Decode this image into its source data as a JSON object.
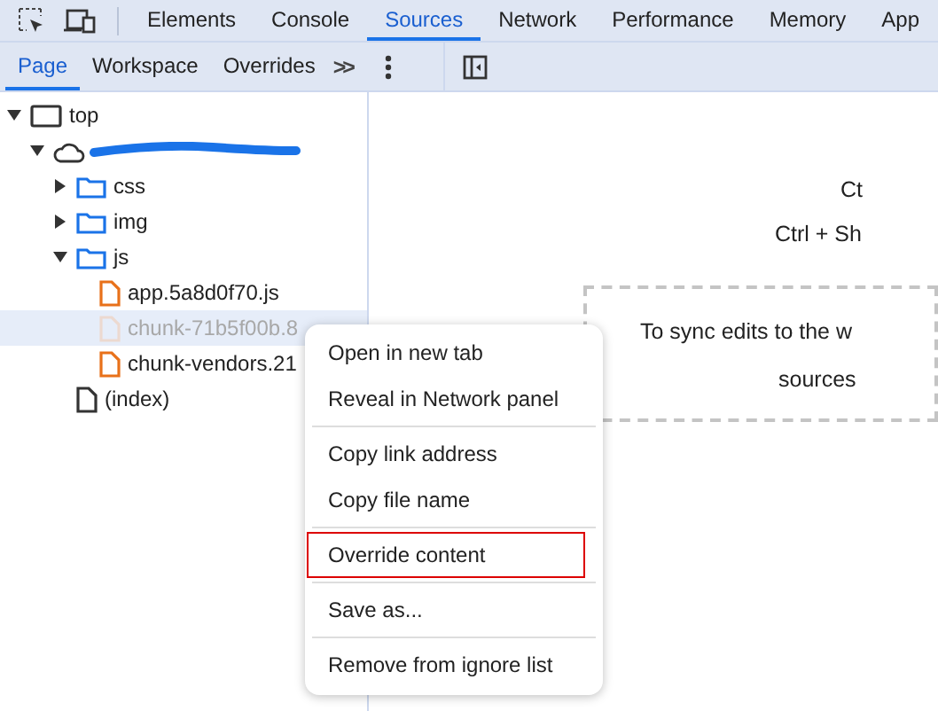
{
  "main_tabs": [
    {
      "label": "Elements",
      "selected": false
    },
    {
      "label": "Console",
      "selected": false
    },
    {
      "label": "Sources",
      "selected": true
    },
    {
      "label": "Network",
      "selected": false
    },
    {
      "label": "Performance",
      "selected": false
    },
    {
      "label": "Memory",
      "selected": false
    },
    {
      "label": "App",
      "selected": false
    }
  ],
  "sub_tabs": [
    {
      "label": "Page",
      "selected": true
    },
    {
      "label": "Workspace",
      "selected": false
    },
    {
      "label": "Overrides",
      "selected": false
    }
  ],
  "more_tabs": ">>",
  "tree": [
    {
      "kind": "frame",
      "label": "top",
      "expanded": true,
      "selected": false,
      "ignored": false,
      "children": [
        {
          "kind": "host",
          "expanded": true,
          "selected": false,
          "ignored": false,
          "children": [
            {
              "kind": "folder",
              "label": "css",
              "expanded": false,
              "selected": false,
              "ignored": false
            },
            {
              "kind": "folder",
              "label": "img",
              "expanded": false,
              "selected": false,
              "ignored": false
            },
            {
              "kind": "folder",
              "label": "js",
              "expanded": true,
              "selected": false,
              "ignored": false,
              "children": [
                {
                  "kind": "script",
                  "label": "app.5a8d0f70.js",
                  "selected": false,
                  "ignored": false
                },
                {
                  "kind": "script",
                  "label": "chunk-71b5f00b.8",
                  "selected": true,
                  "ignored": true
                },
                {
                  "kind": "script",
                  "label": "chunk-vendors.21",
                  "selected": false,
                  "ignored": false
                }
              ]
            },
            {
              "kind": "document",
              "label": "(index)",
              "selected": false,
              "ignored": false
            }
          ]
        }
      ]
    }
  ],
  "editor_hints": {
    "line_1": "Ct",
    "line_2": "Ctrl + Sh",
    "drop_zone": [
      "To sync edits to the w",
      "sources"
    ]
  },
  "context_menu": [
    [
      {
        "label": "Open in new tab",
        "outlined": false
      },
      {
        "label": "Reveal in Network panel",
        "outlined": false
      }
    ],
    [
      {
        "label": "Copy link address",
        "outlined": false
      },
      {
        "label": "Copy file name",
        "outlined": false
      }
    ],
    [
      {
        "label": "Override content",
        "outlined": true
      }
    ],
    [
      {
        "label": "Save as...",
        "outlined": false
      }
    ],
    [
      {
        "label": "Remove from ignore list",
        "outlined": false
      }
    ]
  ]
}
